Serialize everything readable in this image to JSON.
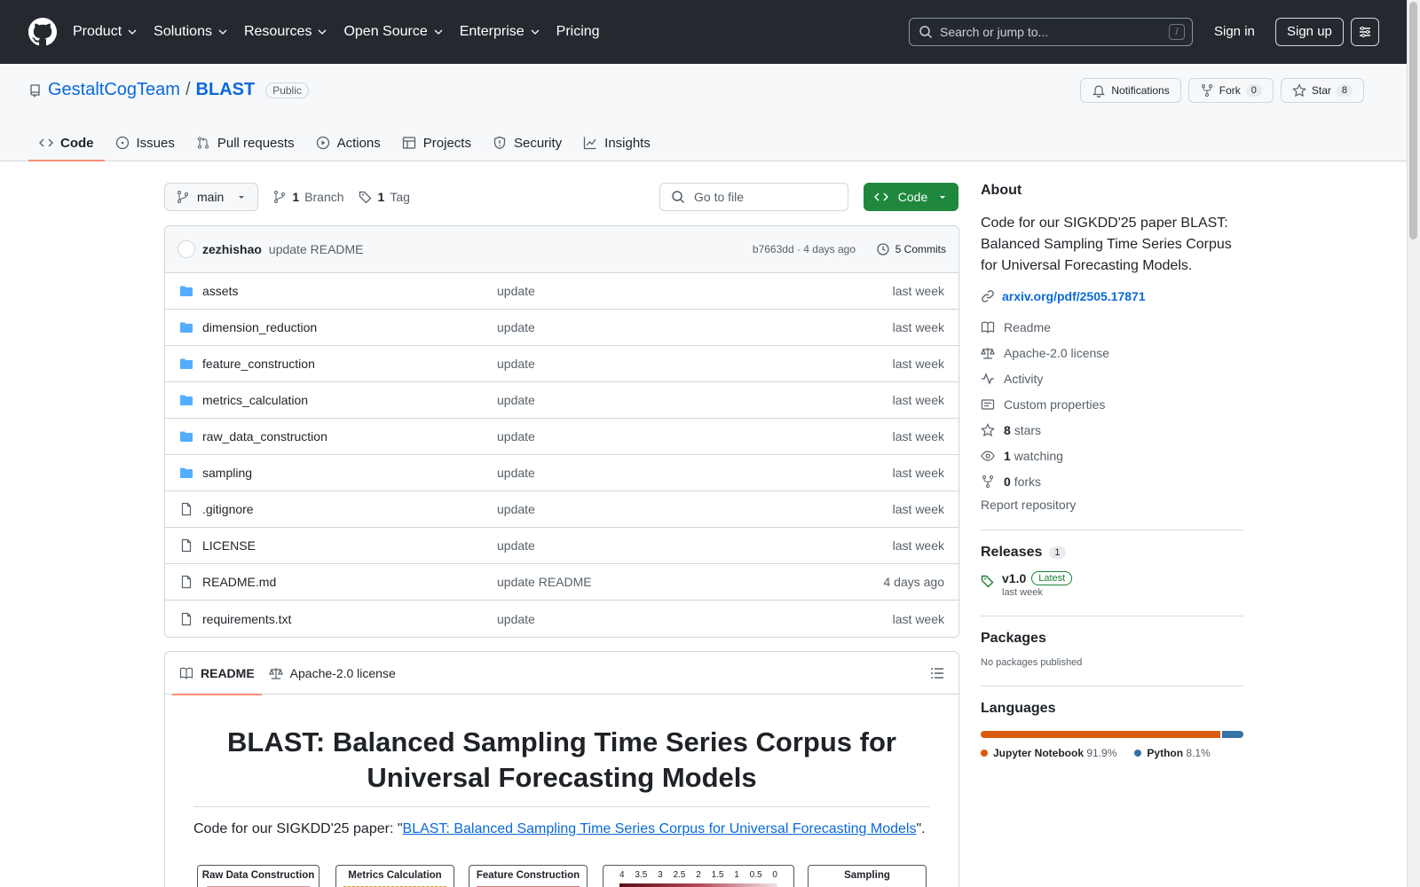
{
  "topnav": {
    "items": [
      "Product",
      "Solutions",
      "Resources",
      "Open Source",
      "Enterprise",
      "Pricing"
    ],
    "search_placeholder": "Search or jump to...",
    "search_shortcut": "/",
    "signin": "Sign in",
    "signup": "Sign up"
  },
  "repo": {
    "owner": "GestaltCogTeam",
    "separator": "/",
    "name": "BLAST",
    "visibility": "Public",
    "notifications": "Notifications",
    "fork_label": "Fork",
    "fork_count": "0",
    "star_label": "Star",
    "star_count": "8"
  },
  "tabs": [
    "Code",
    "Issues",
    "Pull requests",
    "Actions",
    "Projects",
    "Security",
    "Insights"
  ],
  "toolbar": {
    "branch": "main",
    "branch_count": "1",
    "branch_label": "Branch",
    "tag_count": "1",
    "tag_label": "Tag",
    "goto_placeholder": "Go to file",
    "code_button": "Code"
  },
  "commit": {
    "user": "zezhishao",
    "message": "update README",
    "hash_age": "b7663dd · 4 days ago",
    "commits": "5 Commits"
  },
  "files": [
    {
      "name": "assets",
      "type": "dir",
      "msg": "update",
      "age": "last week"
    },
    {
      "name": "dimension_reduction",
      "type": "dir",
      "msg": "update",
      "age": "last week"
    },
    {
      "name": "feature_construction",
      "type": "dir",
      "msg": "update",
      "age": "last week"
    },
    {
      "name": "metrics_calculation",
      "type": "dir",
      "msg": "update",
      "age": "last week"
    },
    {
      "name": "raw_data_construction",
      "type": "dir",
      "msg": "update",
      "age": "last week"
    },
    {
      "name": "sampling",
      "type": "dir",
      "msg": "update",
      "age": "last week"
    },
    {
      "name": ".gitignore",
      "type": "file",
      "msg": "update",
      "age": "last week"
    },
    {
      "name": "LICENSE",
      "type": "file",
      "msg": "update",
      "age": "last week"
    },
    {
      "name": "README.md",
      "type": "file",
      "msg": "update README",
      "age": "4 days ago"
    },
    {
      "name": "requirements.txt",
      "type": "file",
      "msg": "update",
      "age": "last week"
    }
  ],
  "readme": {
    "tab_readme": "README",
    "tab_license": "Apache-2.0 license",
    "title": "BLAST: Balanced Sampling Time Series Corpus for Universal Forecasting Models",
    "intro_prefix": "Code for our SIGKDD'25 paper: \"",
    "intro_link": "BLAST: Balanced Sampling Time Series Corpus for Universal Forecasting Models",
    "intro_suffix": "\".",
    "diagram": {
      "boxes": [
        "Raw Data Construction",
        "Metrics Calculation",
        "Feature Construction",
        "Sampling"
      ],
      "scale_ticks": [
        "4",
        "3.5",
        "3",
        "2.5",
        "2",
        "1.5",
        "1",
        "0.5",
        "0"
      ]
    }
  },
  "about": {
    "heading": "About",
    "description": "Code for our SIGKDD'25 paper BLAST: Balanced Sampling Time Series Corpus for Universal Forecasting Models.",
    "link": "arxiv.org/pdf/2505.17871",
    "readme": "Readme",
    "license": "Apache-2.0 license",
    "activity": "Activity",
    "custom_properties": "Custom properties",
    "stars_count": "8",
    "stars_label": "stars",
    "watching_count": "1",
    "watching_label": "watching",
    "forks_count": "0",
    "forks_label": "forks",
    "report": "Report repository"
  },
  "releases": {
    "heading": "Releases",
    "count": "1",
    "version": "v1.0",
    "badge": "Latest",
    "date": "last week"
  },
  "packages": {
    "heading": "Packages",
    "text": "No packages published"
  },
  "languages": {
    "heading": "Languages",
    "items": [
      {
        "name": "Jupyter Notebook",
        "percent": "91.9%",
        "value": 91.9,
        "color": "#DA5B0B"
      },
      {
        "name": "Python",
        "percent": "8.1%",
        "value": 8.1,
        "color": "#3572A5"
      }
    ]
  }
}
